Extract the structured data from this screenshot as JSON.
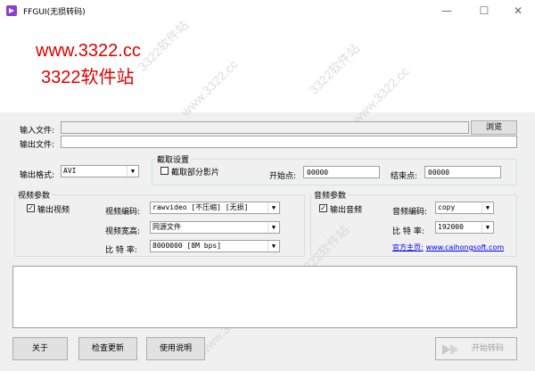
{
  "window": {
    "title": "FFGUI(无损转码)",
    "min": "—",
    "max": "☐",
    "close": "✕"
  },
  "watermark": {
    "line1": "www.3322.cc",
    "line2": "3322软件站",
    "diag": [
      "3322软件站",
      "www.3322.cc",
      "3322软件站",
      "www.3322.cc",
      "3322软件站",
      "www.3322.cc"
    ]
  },
  "input_file": {
    "label": "输入文件:",
    "value": "",
    "browse": "浏览"
  },
  "output_file": {
    "label": "输出文件:",
    "value": ""
  },
  "format": {
    "label": "输出格式:",
    "value": "AVI"
  },
  "clip": {
    "title": "截取设置",
    "partial_label": "截取部分影片",
    "partial_checked": false,
    "start_label": "开始点:",
    "start_value": "00000",
    "end_label": "结束点:",
    "end_value": "00000"
  },
  "video": {
    "title": "视频参数",
    "output_label": "输出视频",
    "output_checked": true,
    "codec_label": "视频编码:",
    "codec_value": "rawvideo [不压缩] [无损]",
    "size_label": "视频宽高:",
    "size_value": "同源文件",
    "bitrate_label": "比 特 率:",
    "bitrate_value": "8000000 [8M bps]"
  },
  "audio": {
    "title": "音频参数",
    "output_label": "输出音频",
    "output_checked": true,
    "codec_label": "音频编码:",
    "codec_value": "copy",
    "bitrate_label": "比 特 率:",
    "bitrate_value": "192000",
    "homepage_label": "官方主页:",
    "homepage_url": "www.caihongsoft.com"
  },
  "buttons": {
    "about": "关于",
    "update": "检查更新",
    "help": "使用说明",
    "start": "开始转码"
  },
  "checkmark": "✓",
  "dropdown_arrow": "▼"
}
